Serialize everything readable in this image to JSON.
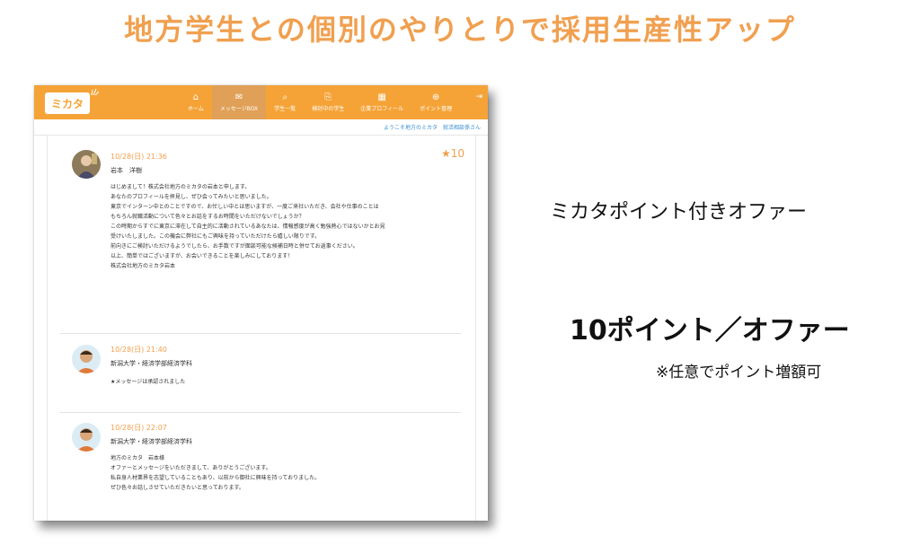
{
  "headline": "地方学生との個別のやりとりで採用生産性アップ",
  "app": {
    "logo": "ミカタ",
    "nav": [
      {
        "label": "ホーム",
        "icon": "home-icon",
        "glyph": "⌂"
      },
      {
        "label": "メッセージBOX",
        "icon": "mail-icon",
        "glyph": "✉"
      },
      {
        "label": "学生一覧",
        "icon": "search-icon",
        "glyph": "⌕"
      },
      {
        "label": "検討中の学生",
        "icon": "paperclip-icon",
        "glyph": "⎘"
      },
      {
        "label": "企業プロフィール",
        "icon": "building-icon",
        "glyph": "▦"
      },
      {
        "label": "ポイント管理",
        "icon": "plus-circle-icon",
        "glyph": "⊕"
      }
    ],
    "active_nav": 1,
    "welcome": "ようこそ地方のミカタ　就活相談係さん",
    "messages": [
      {
        "date": "10/28(日) 21:36",
        "sender": "岩本　洋樹",
        "points": "★10",
        "body": [
          "はじめまして！株式会社地方のミカタの岩本と申します。",
          "",
          "あなたのプロフィールを拝見し、ぜひ会ってみたいと思いました。",
          "東京でインターン中とのことですので、お忙しい中とは思いますが、一度ご来社いただき、会社や仕事のことは",
          "もちろん就職活動について色々とお話をするお時間をいただけないでしょうか？",
          "",
          "この時期からすでに東京に滞在して自主的に活動されているあなたは、情報感度が高く勉強熱心ではないかとお見",
          "受けいたしました。この機会に弊社にもご興味を持っていただけたら嬉しい限りです。",
          "前向きにご検討いただけるようでしたら、お手数ですが面談可能な候補日時と併せてお返事ください。",
          "",
          "以上、簡単ではございますが、お会いできることを楽しみにしております！",
          "株式会社地方のミカタ岩本"
        ]
      },
      {
        "date": "10/28(日) 21:40",
        "sender": "新潟大学・経済学部経済学科",
        "body": [
          "★メッセージは承認されました"
        ]
      },
      {
        "date": "10/28(日) 22:07",
        "sender": "新潟大学・経済学部経済学科",
        "body": [
          "地方のミカタ　岩本様",
          "",
          "オファーとメッセージをいただきまして、ありがとうございます。",
          "私自身人材業界を志望していることもあり、以前から御社に興味を持っておりました。",
          "",
          "ぜひ色々お話しさせていただきたいと思っております。"
        ]
      }
    ]
  },
  "side": {
    "offer_title": "ミカタポイント付きオファー",
    "points_per_offer": "10ポイント／オファー",
    "note": "※任意でポイント増額可"
  },
  "colors": {
    "accent": "#f5a337",
    "headline": "#f0a050",
    "link": "#3a8fd0"
  }
}
